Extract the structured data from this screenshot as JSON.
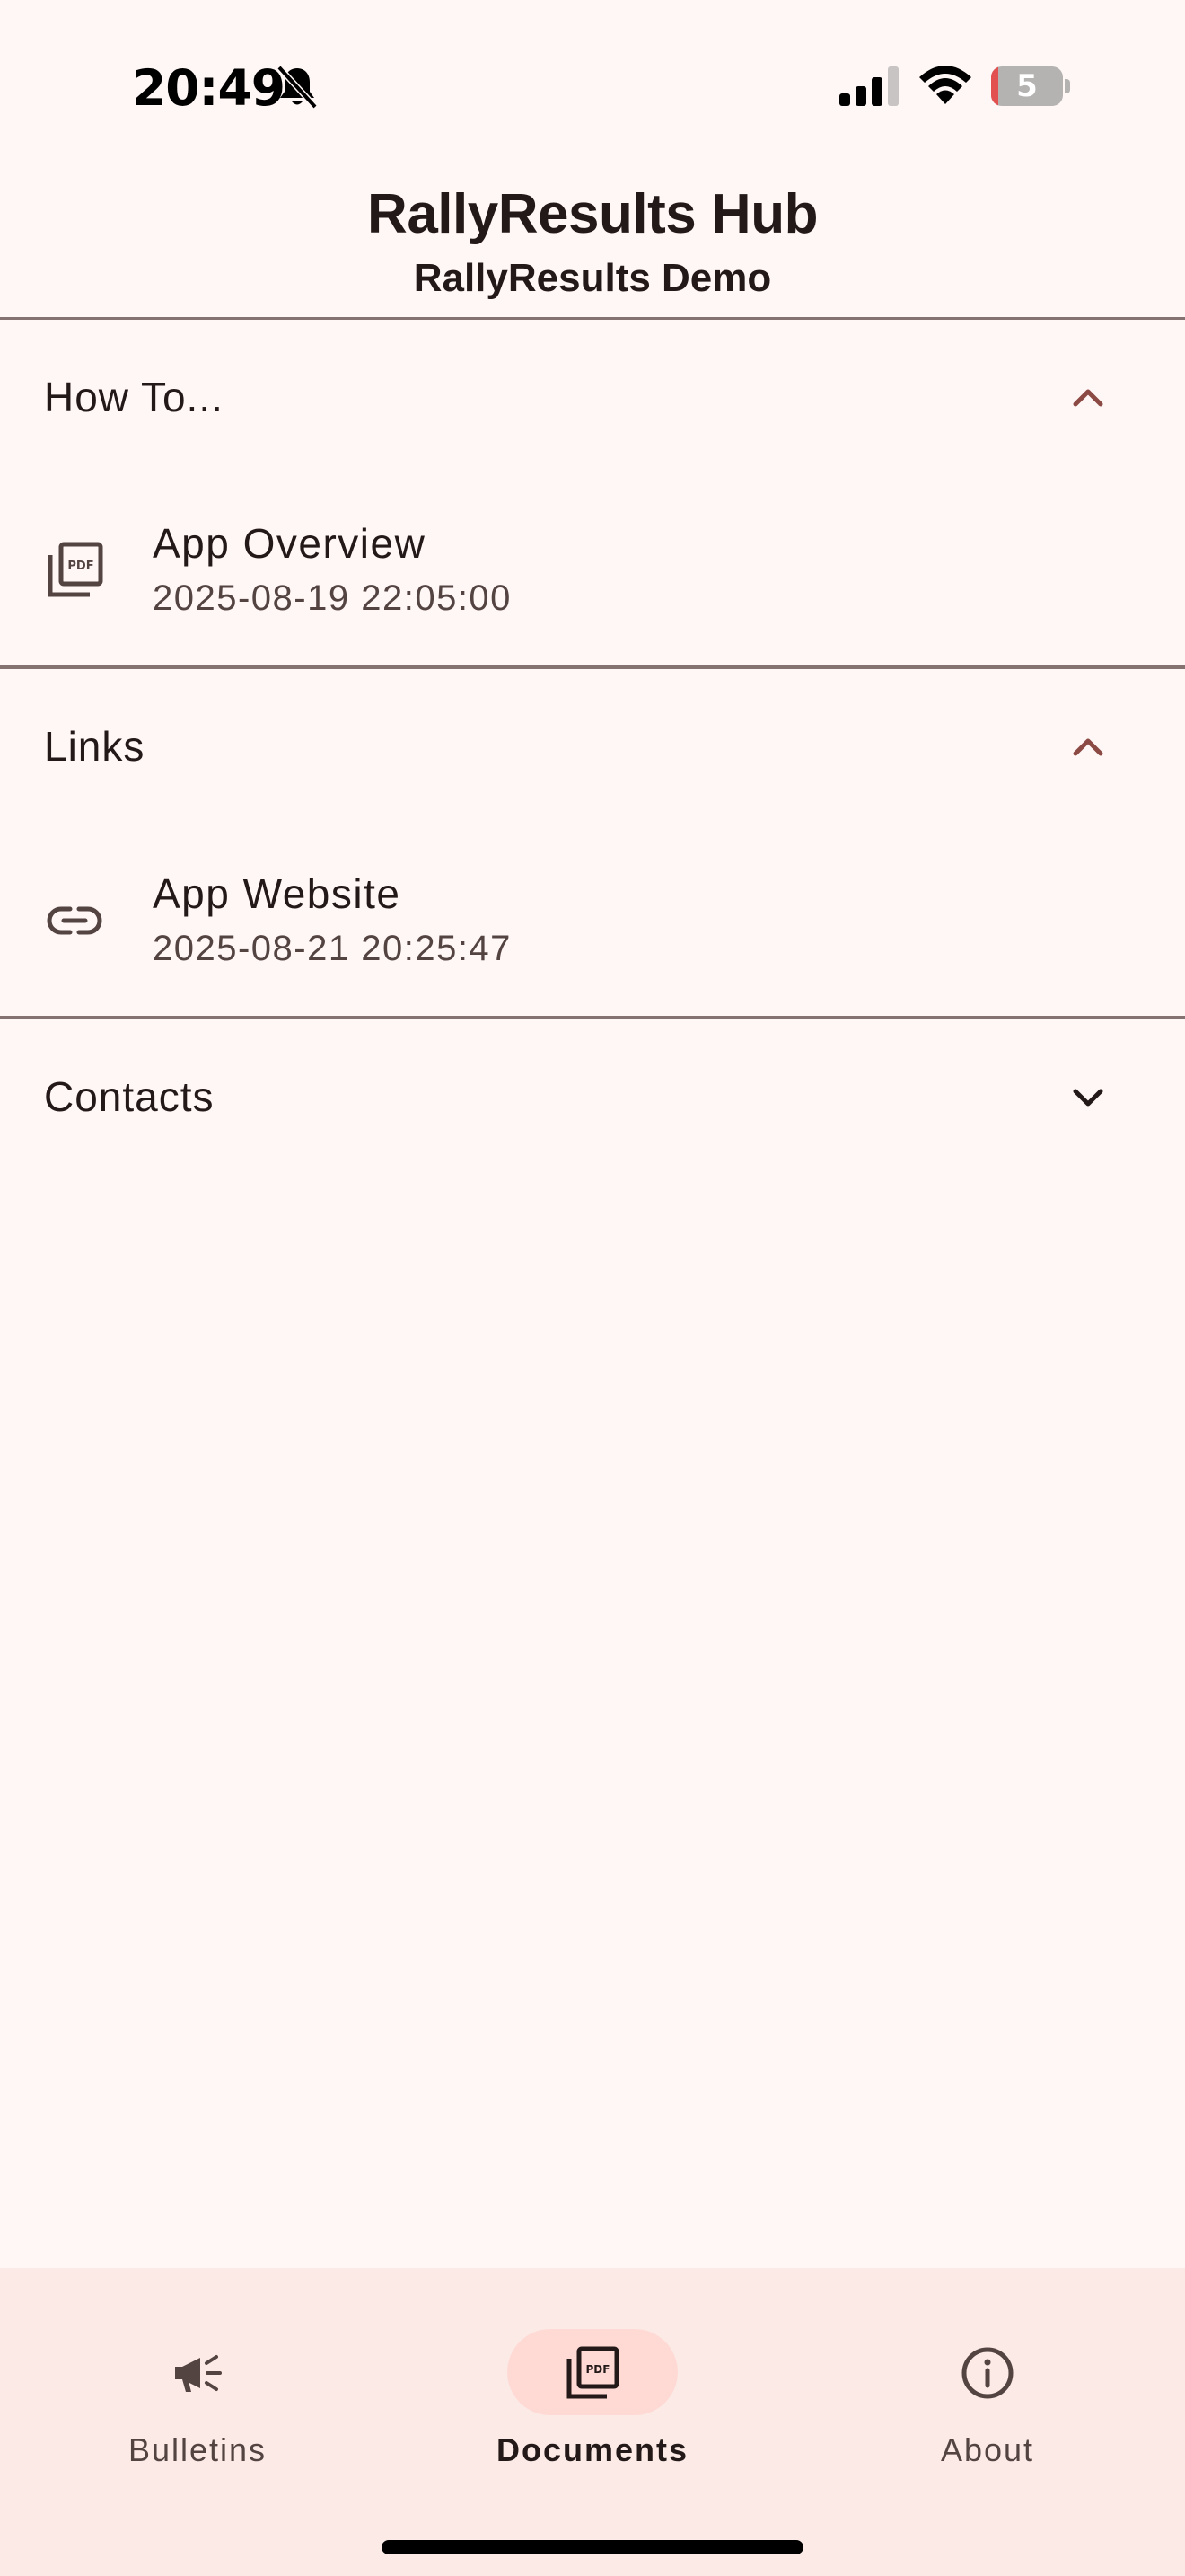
{
  "status_bar": {
    "time": "20:49",
    "battery_level": "5",
    "icons": [
      "bell-off-icon",
      "signal-icon",
      "wifi-icon",
      "battery-icon"
    ]
  },
  "header": {
    "title": "RallyResults Hub",
    "subtitle": "RallyResults Demo"
  },
  "sections": [
    {
      "title": "How To...",
      "expanded": true,
      "items": [
        {
          "icon": "pdf-document-icon",
          "title": "App Overview",
          "timestamp": "2025-08-19 22:05:00"
        }
      ]
    },
    {
      "title": "Links",
      "expanded": true,
      "items": [
        {
          "icon": "link-icon",
          "title": "App Website",
          "timestamp": "2025-08-21 20:25:47"
        }
      ]
    },
    {
      "title": "Contacts",
      "expanded": false,
      "items": []
    }
  ],
  "bottom_nav": {
    "items": [
      {
        "label": "Bulletins",
        "icon": "megaphone-icon",
        "active": false
      },
      {
        "label": "Documents",
        "icon": "pdf-document-icon",
        "active": true
      },
      {
        "label": "About",
        "icon": "info-icon",
        "active": false
      }
    ]
  },
  "colors": {
    "background": "#fff7f5",
    "accent": "#8c4a44",
    "nav_background": "#fbeae6",
    "active_pill": "#ffdad5",
    "text_primary": "#231918",
    "text_secondary": "#534341",
    "divider": "#857371"
  }
}
